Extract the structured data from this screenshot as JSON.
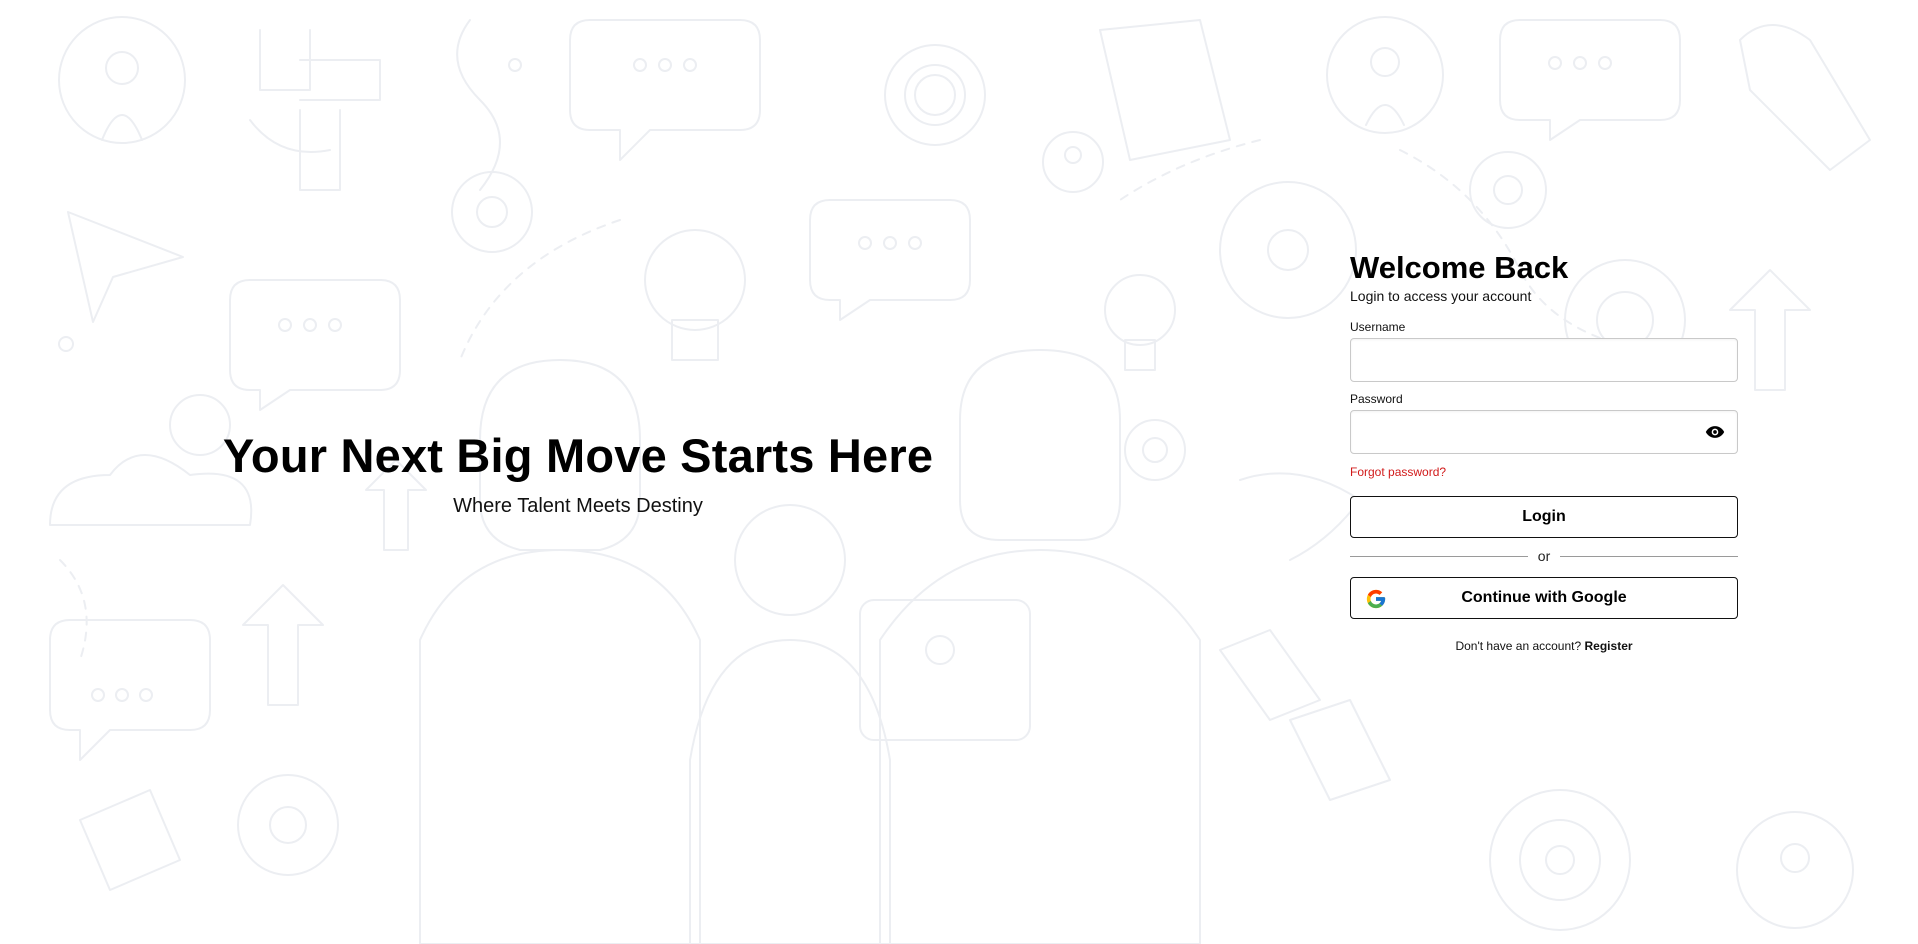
{
  "hero": {
    "title": "Your Next Big Move Starts Here",
    "subtitle": "Where Talent Meets Destiny"
  },
  "login": {
    "heading": "Welcome Back",
    "subheading": "Login to access your account",
    "username_label": "Username",
    "username_value": "",
    "password_label": "Password",
    "password_value": "",
    "forgot_password": "Forgot password?",
    "login_button": "Login",
    "divider_text": "or",
    "google_button": "Continue with Google",
    "no_account_text": "Don't have an account?",
    "register_link": "Register"
  },
  "icons": {
    "password_toggle": "eye-icon",
    "google": "google-logo-icon"
  },
  "colors": {
    "forgot_link": "#d11a1a",
    "button_border": "#111111",
    "background_doodles": "#eceef2"
  }
}
